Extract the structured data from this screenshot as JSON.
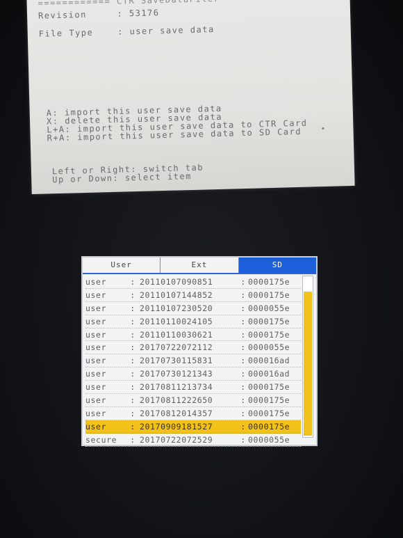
{
  "top_screen": {
    "header_title": "============ CTR SaveDataFiler",
    "revision": "Revision     : 53176",
    "file_type": "File Type    : user save data",
    "instructions": [
      "A: import this user save data",
      "X: delete this user save data",
      "L+A: import this user save data to CTR Card",
      "R+A: import this user save data to SD Card"
    ],
    "nav": [
      "Left or Right: switch tab",
      "Up or Down: select item"
    ]
  },
  "bottom_screen": {
    "tabs": [
      {
        "label": "User",
        "active": false
      },
      {
        "label": "Ext",
        "active": false
      },
      {
        "label": "SD",
        "active": true
      }
    ],
    "rows": [
      {
        "type": "user",
        "date": "20110107090851",
        "id": "0000175e",
        "selected": false
      },
      {
        "type": "user",
        "date": "20110107144852",
        "id": "0000175e",
        "selected": false
      },
      {
        "type": "user",
        "date": "20110107230520",
        "id": "0000055e",
        "selected": false
      },
      {
        "type": "user",
        "date": "20110110024105",
        "id": "0000175e",
        "selected": false
      },
      {
        "type": "user",
        "date": "20110110030621",
        "id": "0000175e",
        "selected": false
      },
      {
        "type": "user",
        "date": "20170722072112",
        "id": "0000055e",
        "selected": false
      },
      {
        "type": "user",
        "date": "20170730115831",
        "id": "000016ad",
        "selected": false
      },
      {
        "type": "user",
        "date": "20170730121343",
        "id": "000016ad",
        "selected": false
      },
      {
        "type": "user",
        "date": "20170811213734",
        "id": "0000175e",
        "selected": false
      },
      {
        "type": "user",
        "date": "20170811222650",
        "id": "0000175e",
        "selected": false
      },
      {
        "type": "user",
        "date": "20170812014357",
        "id": "0000175e",
        "selected": false
      },
      {
        "type": "user",
        "date": "20170909181527",
        "id": "0000175e",
        "selected": true
      },
      {
        "type": "secure",
        "date": "20170722072529",
        "id": "0000055e",
        "selected": false
      }
    ],
    "separator": ":",
    "colors": {
      "tab_active": "#1d5fd8",
      "selection": "#f2c21a",
      "scroll_thumb": "#f1c11c"
    }
  }
}
